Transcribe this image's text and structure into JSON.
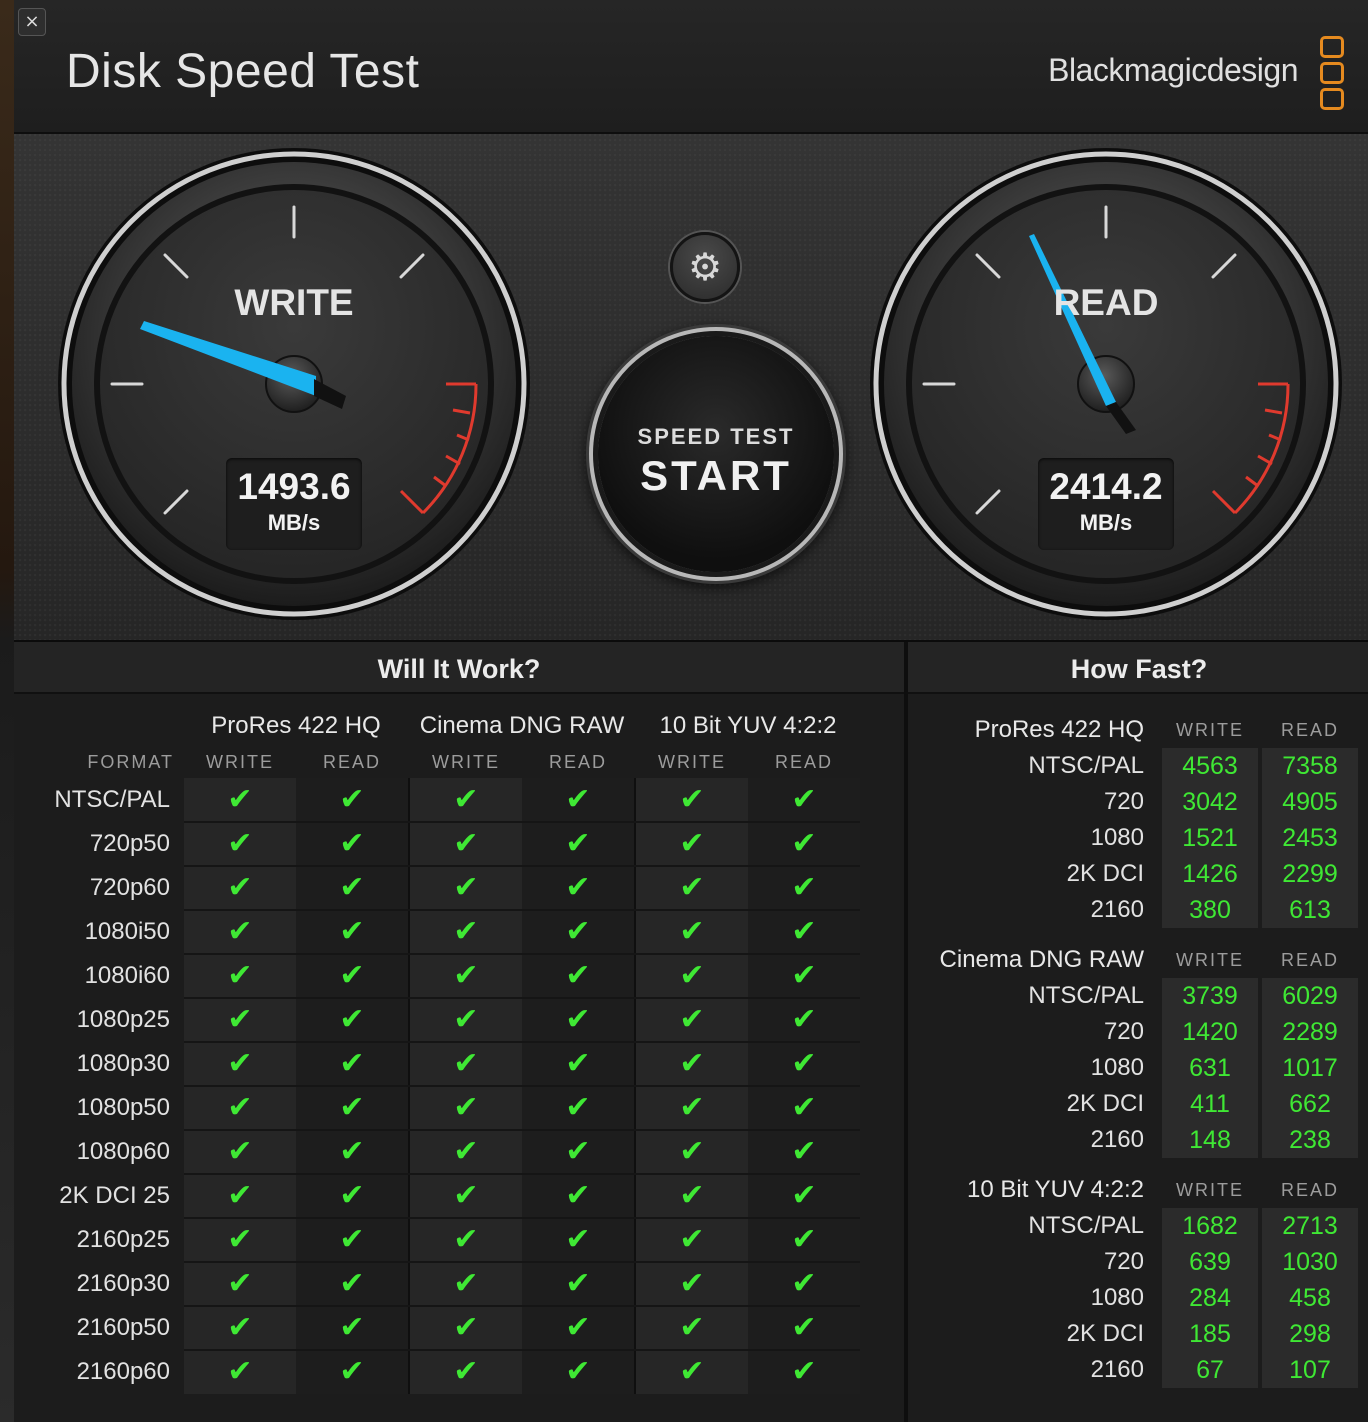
{
  "window": {
    "close_label": "×"
  },
  "header": {
    "title": "Disk Speed Test",
    "brand": "Blackmagicdesign"
  },
  "colors": {
    "accent_needle": "#1ab3f0",
    "check": "#3fe834",
    "brand_orange": "#e58a1f",
    "redline": "#e03a2e"
  },
  "gauges": {
    "write": {
      "label": "WRITE",
      "value": "1493.6",
      "unit": "MB/s"
    },
    "read": {
      "label": "READ",
      "value": "2414.2",
      "unit": "MB/s"
    }
  },
  "settings": {
    "icon": "gear-icon",
    "glyph": "⚙"
  },
  "start": {
    "small": "SPEED TEST",
    "big": "START"
  },
  "will_it_work": {
    "title": "Will It Work?",
    "format_header": "FORMAT",
    "groups": [
      "ProRes 422 HQ",
      "Cinema DNG RAW",
      "10 Bit YUV 4:2:2"
    ],
    "write_label": "WRITE",
    "read_label": "READ",
    "check_glyph": "✔",
    "formats": [
      "NTSC/PAL",
      "720p50",
      "720p60",
      "1080i50",
      "1080i60",
      "1080p25",
      "1080p30",
      "1080p50",
      "1080p60",
      "2K DCI 25",
      "2160p25",
      "2160p30",
      "2160p50",
      "2160p60"
    ]
  },
  "how_fast": {
    "title": "How Fast?",
    "write_label": "WRITE",
    "read_label": "READ",
    "groups": [
      {
        "name": "ProRes 422 HQ",
        "rows": [
          {
            "label": "NTSC/PAL",
            "write": "4563",
            "read": "7358"
          },
          {
            "label": "720",
            "write": "3042",
            "read": "4905"
          },
          {
            "label": "1080",
            "write": "1521",
            "read": "2453"
          },
          {
            "label": "2K DCI",
            "write": "1426",
            "read": "2299"
          },
          {
            "label": "2160",
            "write": "380",
            "read": "613"
          }
        ]
      },
      {
        "name": "Cinema DNG RAW",
        "rows": [
          {
            "label": "NTSC/PAL",
            "write": "3739",
            "read": "6029"
          },
          {
            "label": "720",
            "write": "1420",
            "read": "2289"
          },
          {
            "label": "1080",
            "write": "631",
            "read": "1017"
          },
          {
            "label": "2K DCI",
            "write": "411",
            "read": "662"
          },
          {
            "label": "2160",
            "write": "148",
            "read": "238"
          }
        ]
      },
      {
        "name": "10 Bit YUV 4:2:2",
        "rows": [
          {
            "label": "NTSC/PAL",
            "write": "1682",
            "read": "2713"
          },
          {
            "label": "720",
            "write": "639",
            "read": "1030"
          },
          {
            "label": "1080",
            "write": "284",
            "read": "458"
          },
          {
            "label": "2K DCI",
            "write": "185",
            "read": "298"
          },
          {
            "label": "2160",
            "write": "67",
            "read": "107"
          }
        ]
      }
    ]
  }
}
